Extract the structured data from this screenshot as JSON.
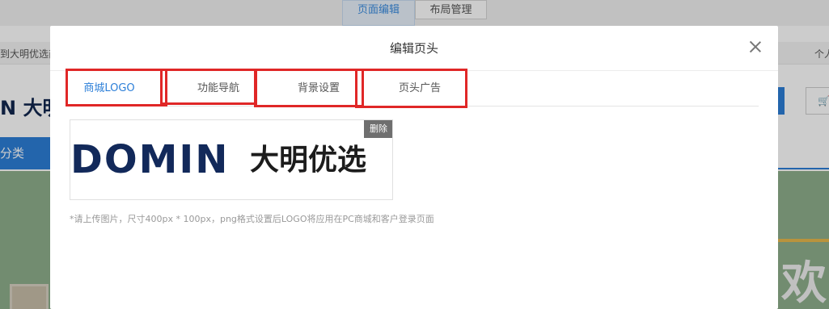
{
  "background": {
    "top_tabs": [
      {
        "label": "页面编辑"
      },
      {
        "label": "布局管理"
      }
    ],
    "strip_left_text": "到大明优选商",
    "strip_right_text": "个人",
    "logo_partial": "N 大明",
    "category_nav_label": "分类",
    "cart_icon": "cart-icon",
    "hero_text": "欢"
  },
  "modal": {
    "title": "编辑页头",
    "close_icon": "close-icon",
    "tabs": [
      {
        "label": "商城LOGO",
        "active": true
      },
      {
        "label": "功能导航",
        "active": false
      },
      {
        "label": "背景设置",
        "active": false
      },
      {
        "label": "页头广告",
        "active": false
      }
    ],
    "logo": {
      "brand_en": "DOMIN",
      "brand_cn": "大明优选",
      "delete_label": "删除"
    },
    "hint": "*请上传图片，尺寸400px * 100px，png格式设置后LOGO将应用在PC商城和客户登录页面"
  },
  "colors": {
    "accent": "#2c7fd8",
    "highlight": "#e02727",
    "brand_navy": "#12295a"
  }
}
